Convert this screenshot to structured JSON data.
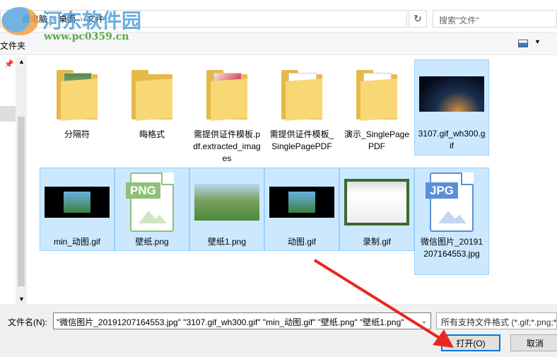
{
  "address": {
    "crumbs": [
      "此电脑",
      "桌面",
      "文件"
    ]
  },
  "search": {
    "placeholder": "搜索\"文件\""
  },
  "toolbar": {
    "new_folder": "文件夹"
  },
  "files": [
    {
      "name": "分隔符",
      "type": "folder"
    },
    {
      "name": "晦格式",
      "type": "folder"
    },
    {
      "name": "需提供证件模板.pdf.extracted_images",
      "type": "folder"
    },
    {
      "name": "需提供证件模板_SinglePagePDF",
      "type": "folder"
    },
    {
      "name": "演示_SinglePagePDF",
      "type": "folder"
    },
    {
      "name": "3107.gif_wh300.gif",
      "type": "image",
      "selected": true
    },
    {
      "name": "min_动图.gif",
      "type": "image",
      "selected": true
    },
    {
      "name": "壁纸.png",
      "type": "png",
      "badge": "PNG",
      "selected": true
    },
    {
      "name": "壁纸1.png",
      "type": "image",
      "selected": true
    },
    {
      "name": "动图.gif",
      "type": "image",
      "selected": true
    },
    {
      "name": "录制.gif",
      "type": "image",
      "selected": true
    },
    {
      "name": "微信图片_20191207164553.jpg",
      "type": "jpg",
      "badge": "JPG",
      "selected": true
    }
  ],
  "bottom": {
    "filename_label": "文件名(N):",
    "filename_value": "\"微信图片_20191207164553.jpg\" \"3107.gif_wh300.gif\" \"min_动图.gif\" \"壁纸.png\" \"壁纸1.png\"",
    "filter": "所有支持文件格式 (*.gif;*.png;*.jpg)",
    "open": "打开(O)",
    "cancel": "取消"
  },
  "watermark": {
    "title": "河东软件园",
    "url": "www.pc0359.cn"
  },
  "colors": {
    "selection": "#cce8ff",
    "accent": "#0078d7",
    "arrow": "#e8281e"
  }
}
